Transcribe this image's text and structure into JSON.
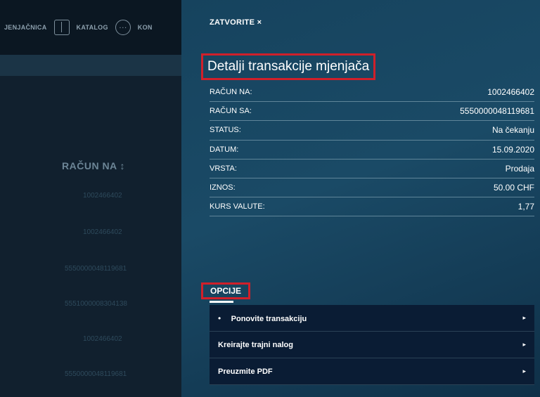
{
  "background": {
    "nav": {
      "item1_label": "JENJAČNICA",
      "item2_label": "KATALOG",
      "item3_label": "KON",
      "item2_icon": "catalog-icon",
      "item3_icon": "chat-icon"
    },
    "table": {
      "column_header": "RAČUN NA ↕",
      "rows": [
        "1002466402",
        "1002466402",
        "5550000048119681",
        "5551000008304138",
        "1002466402",
        "5550000048119681"
      ]
    }
  },
  "panel": {
    "close_label": "ZATVORITE ×",
    "title": "Detalji transakcije mjenjača",
    "details": [
      {
        "label": "RAČUN NA:",
        "value": "1002466402"
      },
      {
        "label": "RAČUN SA:",
        "value": "5550000048119681"
      },
      {
        "label": "STATUS:",
        "value": "Na čekanju"
      },
      {
        "label": "DATUM:",
        "value": "15.09.2020"
      },
      {
        "label": "VRSTA:",
        "value": "Prodaja"
      },
      {
        "label": "IZNOS:",
        "value": "50.00 CHF"
      },
      {
        "label": "KURS VALUTE:",
        "value": "1,77"
      }
    ],
    "options_title": "OPCIJE",
    "options": [
      {
        "label": "Ponovite transakciju",
        "bullet": "•",
        "arrow": "▸"
      },
      {
        "label": "Kreirajte trajni nalog",
        "arrow": "▸"
      },
      {
        "label": "Preuzmite PDF",
        "arrow": "▸"
      }
    ]
  },
  "colors": {
    "highlight_border": "#d0202a",
    "panel_bg": "#16435e",
    "option_bg": "#0a1c34"
  }
}
